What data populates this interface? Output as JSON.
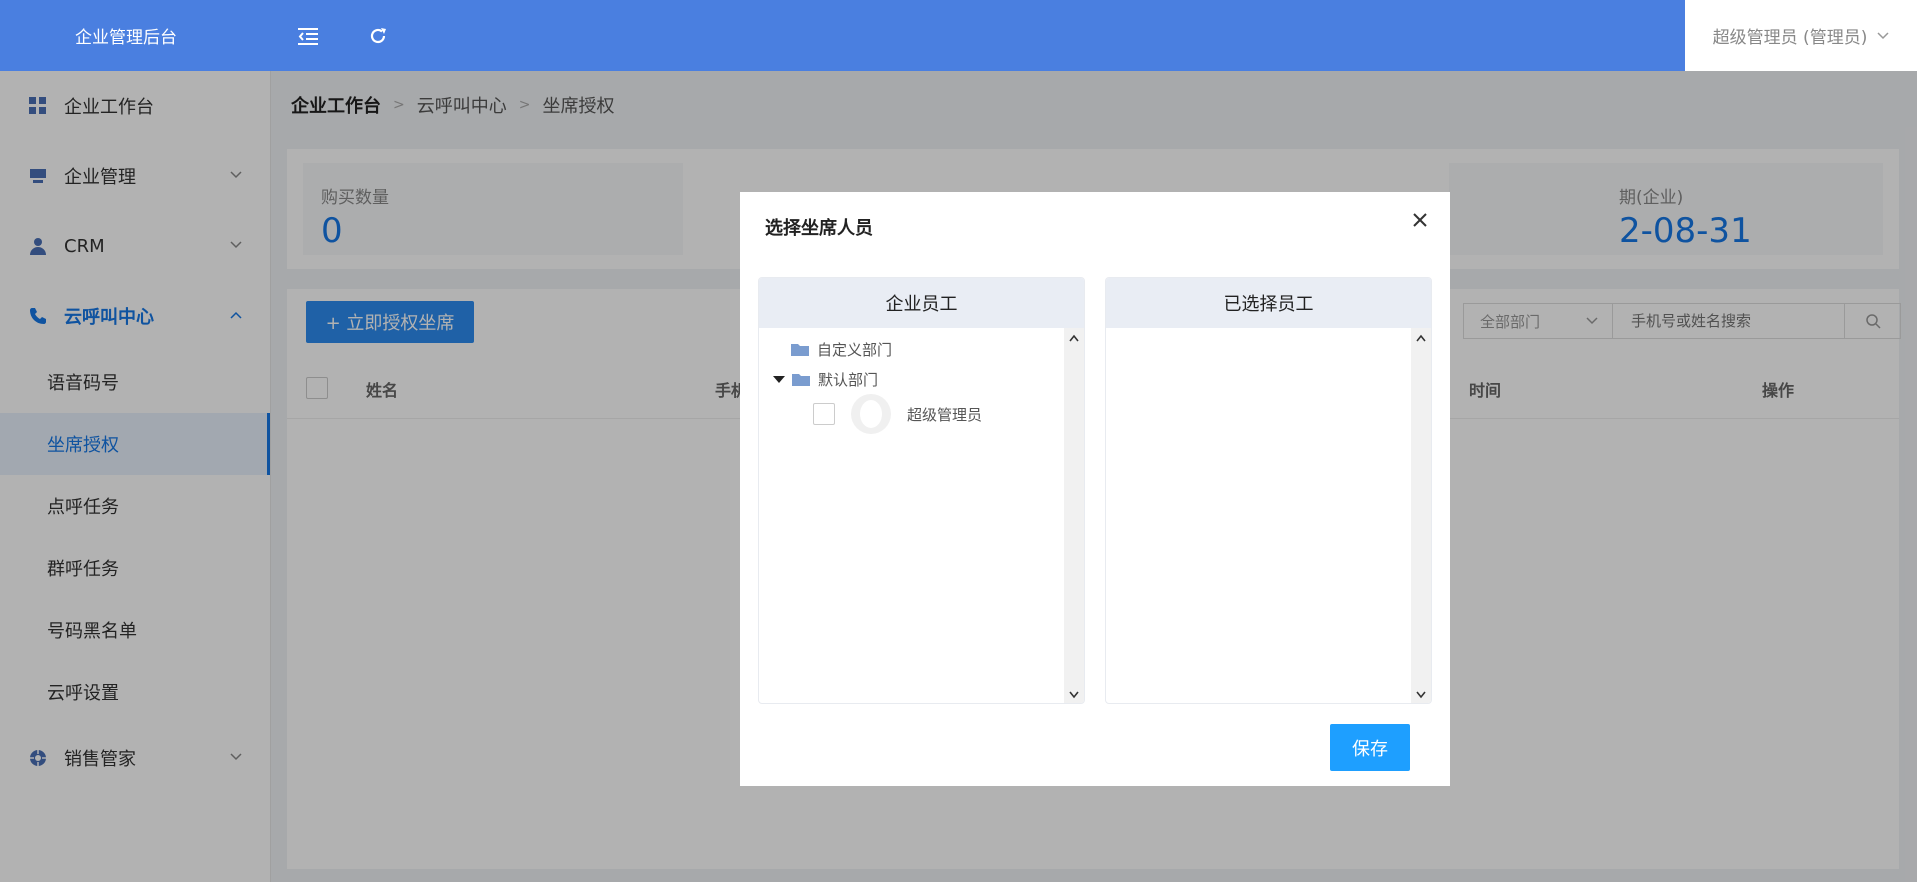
{
  "colors": {
    "topbar": "#4a7fe0",
    "accent": "#1677e6",
    "primary_button": "#2d8cf0",
    "save_button": "#1e9fff"
  },
  "header": {
    "brand": "企业管理后台",
    "collapse_icon": "menu-fold-icon",
    "refresh_icon": "refresh-icon",
    "user": "超级管理员 (管理员)"
  },
  "sidebar": {
    "workbench": "企业工作台",
    "enterprise": "企业管理",
    "crm": "CRM",
    "callcenter": "云呼叫中心",
    "sub": [
      "语音码号",
      "坐席授权",
      "点呼任务",
      "群呼任务",
      "号码黑名单",
      "云呼设置"
    ],
    "sales": "销售管家"
  },
  "breadcrumb": [
    "企业工作台",
    "云呼叫中心",
    "坐席授权"
  ],
  "stats": {
    "purchase_label": "购买数量",
    "purchase_value": "0",
    "expire_label_partial": "期(企业)",
    "expire_value_partial": "2-08-31"
  },
  "toolbar": {
    "auth_button": "+ 立即授权坐席",
    "dept_select": "全部部门",
    "search_placeholder": "手机号或姓名搜索"
  },
  "table": {
    "headers": [
      "姓名",
      "手机",
      "时间",
      "操作"
    ]
  },
  "modal": {
    "title": "选择坐席人员",
    "left_title": "企业员工",
    "right_title": "已选择员工",
    "tree": {
      "dept1": "自定义部门",
      "dept2": "默认部门",
      "employee": "超级管理员"
    },
    "save": "保存"
  }
}
